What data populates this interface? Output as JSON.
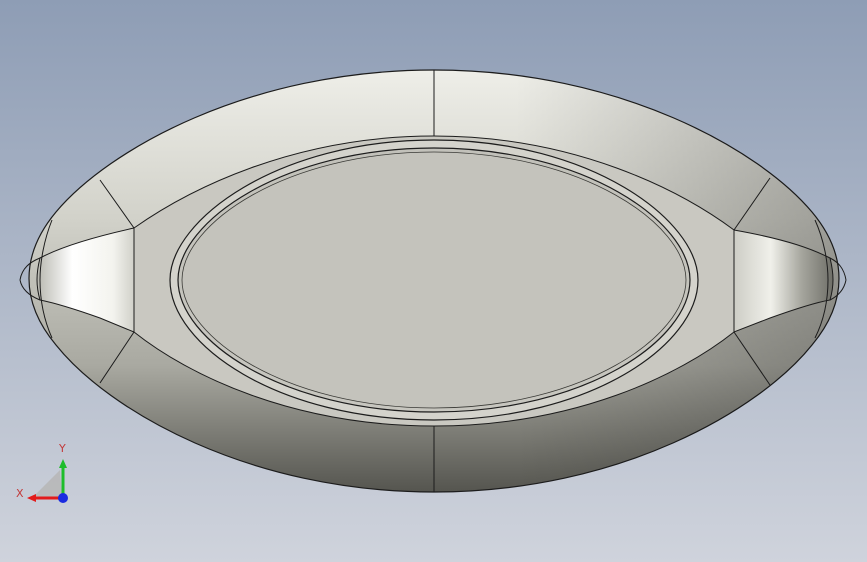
{
  "viewport": {
    "background_top": "#8e9db5",
    "background_bottom": "#cfd3dc"
  },
  "model": {
    "shape": "rounded oval dish",
    "body_color": "#c7c7bf",
    "highlight_color": "#ffffff",
    "shadow_color": "#5e5e58",
    "edge_color": "#1c1c1c",
    "inner_face_color": "#c4c3bc"
  },
  "triad": {
    "x_label": "X",
    "y_label": "Y",
    "x_color": "#e21b1b",
    "y_color": "#1dbd2b",
    "z_color": "#1a2be0",
    "label_color": "#c23a3a",
    "icons": [
      "x-axis-arrow-icon",
      "y-axis-arrow-icon",
      "origin-dot-icon"
    ]
  }
}
